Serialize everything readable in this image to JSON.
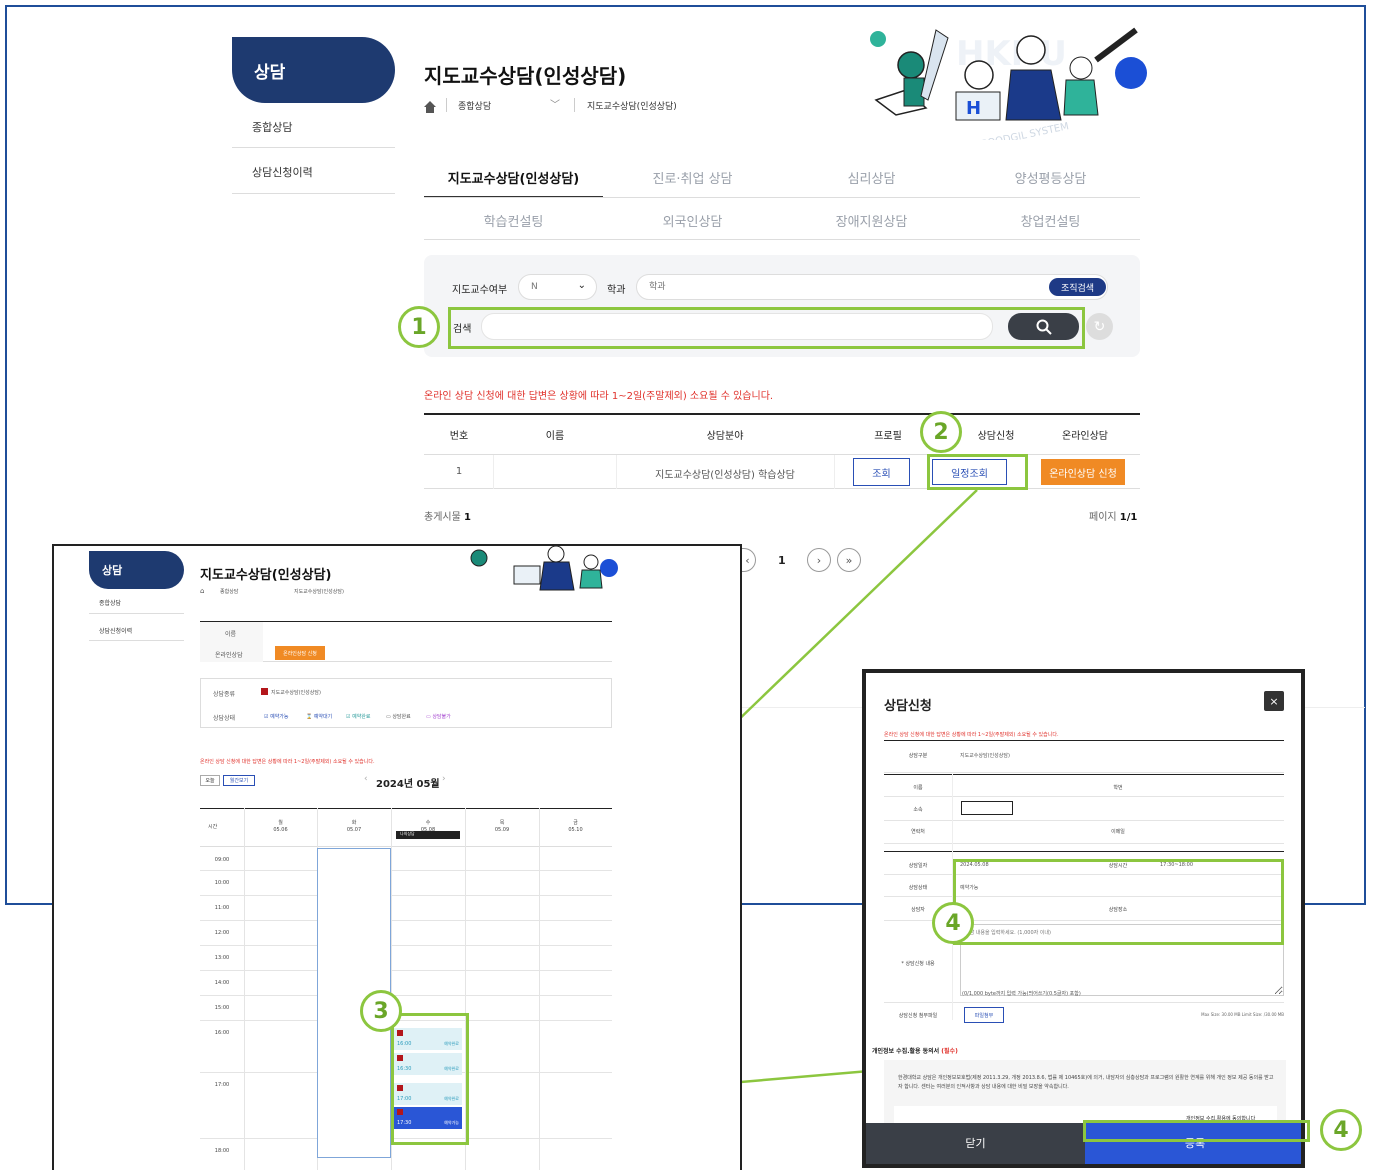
{
  "sidebar": {
    "title": "상담",
    "items": [
      "종합상담",
      "상담신청이력"
    ]
  },
  "page": {
    "title": "지도교수상담(인성상담)",
    "breadcrumb_1": "종합상담",
    "breadcrumb_2": "지도교수상담(인성상담)"
  },
  "banner": {
    "logo_text": "HKNU GOODGIL SYSTEM"
  },
  "tabs": {
    "row1": [
      "지도교수상담(인성상담)",
      "진로·취업 상담",
      "심리상담",
      "양성평등상담"
    ],
    "row2": [
      "학습컨설팅",
      "외국인상담",
      "장애지원상담",
      "창업컨설팅"
    ]
  },
  "search": {
    "advisor_label": "지도교수여부",
    "advisor_value": "N",
    "dept_label": "학과",
    "dept_placeholder": "학과",
    "org_btn": "조직검색",
    "search_label": "검색"
  },
  "notice": "온라인 상담 신청에 대한 답변은 상황에 따라 1~2일(주말제외) 소요될 수 있습니다.",
  "table": {
    "headers": [
      "번호",
      "이름",
      "상담분야",
      "프로필",
      "상담신청",
      "온라인상담"
    ],
    "row": {
      "no": "1",
      "name": "",
      "field": "지도교수상담(인성상담) 학습상담",
      "profile_btn": "조회",
      "schedule_btn": "일정조회",
      "online_btn": "온라인상담 신청"
    }
  },
  "footer": {
    "total_label": "총게시물",
    "total": "1",
    "page_label": "페이지",
    "page": "1/1",
    "current_page": "1"
  },
  "markers": [
    "1",
    "2",
    "3",
    "4",
    "4"
  ],
  "inset": {
    "sidebar_title": "상담",
    "sidebar_items": [
      "종합상담",
      "상담신청이력"
    ],
    "title": "지도교수상담(인성상담)",
    "crumb1": "종합상담",
    "crumb2": "지도교수상담(인성상담)",
    "name_label": "이름",
    "online_label": "온라인상담",
    "online_btn": "온라인상담 신청",
    "kind_label": "상담종류",
    "kind_value": "지도교수상담(인성상담)",
    "state_label": "상담상태",
    "states": [
      "예약가능",
      "예약대기",
      "예약완료",
      "상담완료",
      "상담불가"
    ],
    "notice": "온라인 상담 신청에 대한 답변은 상황에 따라 1~2일(주말제외) 소요될 수 있습니다.",
    "today_btn": "오늘",
    "weekly_btn": "월간보기",
    "month": "2024년 05월",
    "time_header": "시간",
    "days": [
      {
        "dow": "월",
        "date": "05.06"
      },
      {
        "dow": "화",
        "date": "05.07"
      },
      {
        "dow": "수",
        "date": "05.08"
      },
      {
        "dow": "목",
        "date": "05.09"
      },
      {
        "dow": "금",
        "date": "05.10"
      }
    ],
    "day_tag": "나의상담",
    "times": [
      "09:00",
      "10:00",
      "11:00",
      "12:00",
      "13:00",
      "14:00",
      "15:00",
      "16:00",
      "17:00",
      "18:00"
    ],
    "slots": [
      {
        "time": "16:00",
        "status": "예약완료",
        "active": false
      },
      {
        "time": "16:30",
        "status": "예약완료",
        "active": false
      },
      {
        "time": "17:00",
        "status": "예약완료",
        "active": false
      },
      {
        "time": "17:30",
        "status": "예약가능",
        "active": true
      }
    ]
  },
  "modal": {
    "title": "상담신청",
    "notice": "온라인 상담 신청에 대한 답변은 상황에 따라 1~2일(주말제외) 소요될 수 있습니다.",
    "type_label": "상담구분",
    "type_value": "지도교수상담(인성상담)",
    "name_label": "이름",
    "id_label": "학번",
    "dept_label": "소속",
    "phone_label": "연락처",
    "email_label": "이메일",
    "date_label": "상담일자",
    "date_value": "2024.05.08",
    "time_label": "상담시간",
    "time_value": "17:30~18:00",
    "state_label": "상담상태",
    "state_value": "예약가능",
    "counselor_label": "상담자",
    "place_label": "상담장소",
    "content_label": "* 상담신청 내용",
    "content_placeholder": "상담 내용을 입력하세요. (1,000자 이내)",
    "content_counter": "(0/1,000 byte까지 입력 가능(띄어쓰기(0.5글자) 포함)",
    "file_label": "상담신청 첨부파일",
    "file_btn": "파일첨부",
    "file_limit": "Max Size: 30.00 MB Limit Size: /30.00 MB",
    "privacy_title": "개인정보 수집.활용 동의서",
    "privacy_required": "(필수)",
    "privacy_text": "한경대학교 상담은 개인정보보호법(제정 2011.3.29, 개정 2013.8.6, 법률 제 10465호)에 의거, 내담자의 심층상담과 프로그램의 원활한 연계를 위해 개인 정보 제공 동의를 받고자 합니다. 센터는 여러분의 인적사항과 상담 내용에 대한 비밀 보장을 약속합니다.",
    "privacy_agree": "개인정보 수집.활용에 동의합니다",
    "close_btn": "닫기",
    "submit_btn": "등록",
    "x_btn": "×"
  }
}
